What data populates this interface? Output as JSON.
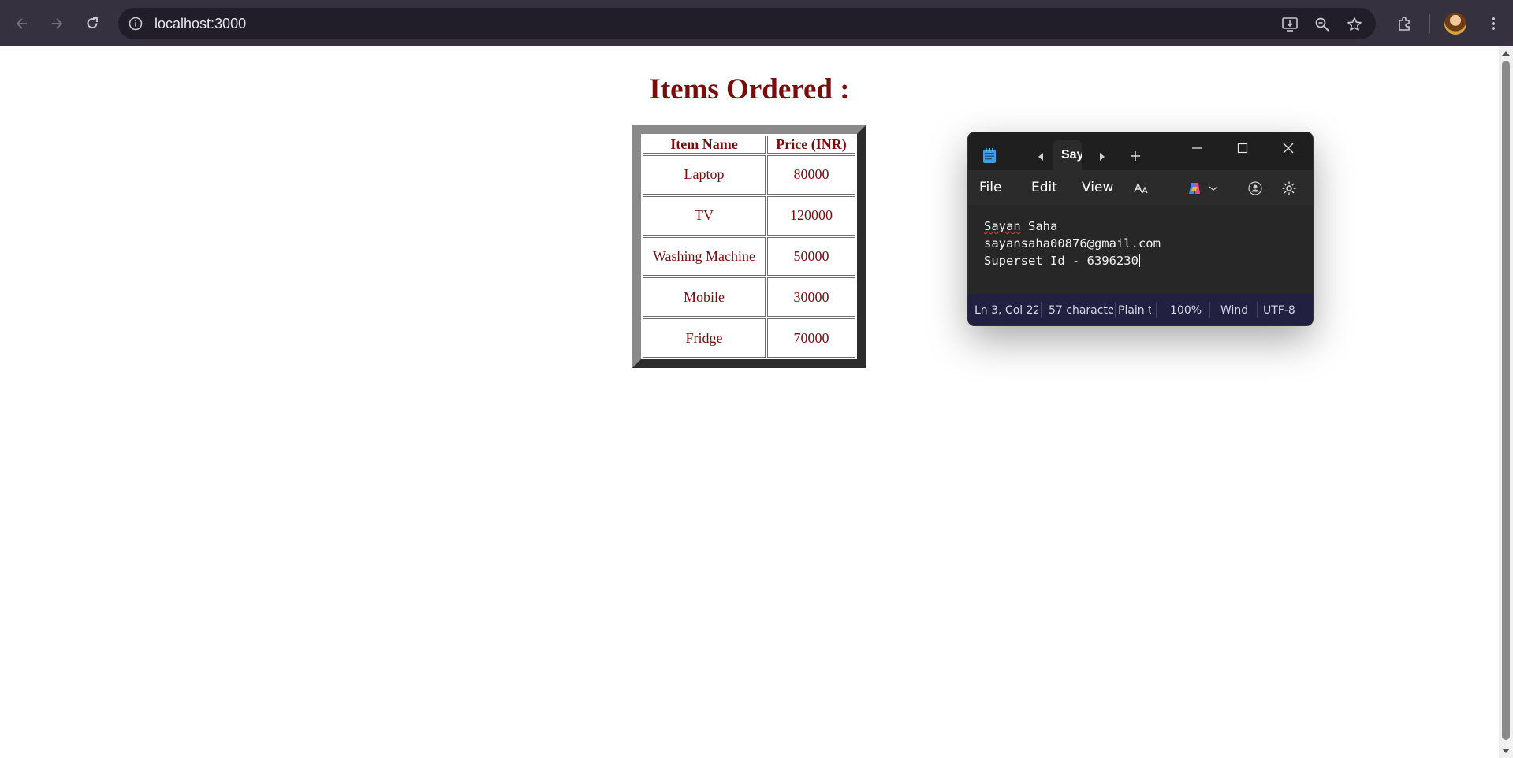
{
  "browser": {
    "url": "localhost:3000"
  },
  "page": {
    "title": "Items Ordered :",
    "table": {
      "headers": [
        "Item Name",
        "Price (INR)"
      ],
      "rows": [
        [
          "Laptop",
          "80000"
        ],
        [
          "TV",
          "120000"
        ],
        [
          "Washing Machine",
          "50000"
        ],
        [
          "Mobile",
          "30000"
        ],
        [
          "Fridge",
          "70000"
        ]
      ]
    }
  },
  "notepad": {
    "tab_label": "Say",
    "menu": {
      "file": "File",
      "edit": "Edit",
      "view": "View"
    },
    "content": {
      "name_first": "Sayan",
      "name_rest": " Saha",
      "line2": "sayansaha00876@gmail.com",
      "line3": "Superset Id - 6396230"
    },
    "status": {
      "position": "Ln 3, Col 22",
      "characters": "57 characte",
      "format": "Plain t",
      "zoom": "100%",
      "line_ending": "Wind",
      "encoding": "UTF-8"
    }
  },
  "colors": {
    "chrome_bg": "#35313f",
    "page_heading": "#7a0c0c",
    "notepad_status_bg": "#212040"
  }
}
